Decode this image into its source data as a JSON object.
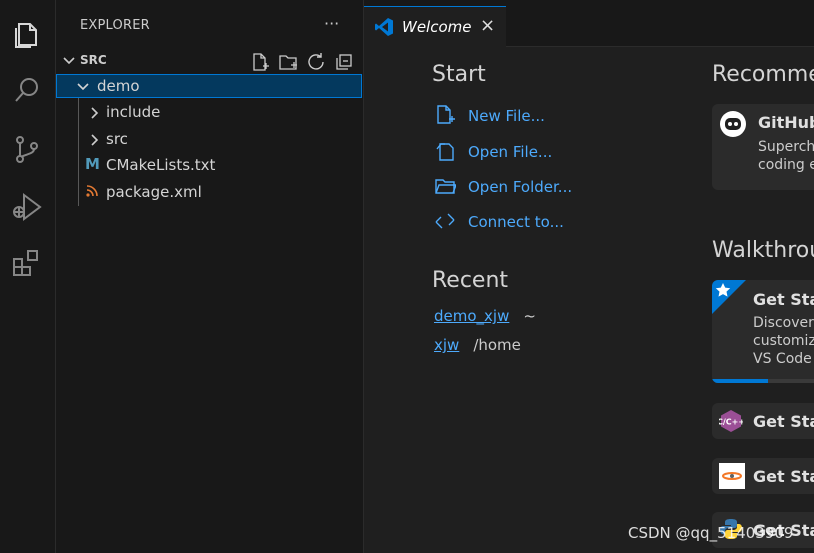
{
  "activity_bar": {
    "icons": [
      "explorer-icon",
      "search-icon",
      "source-control-icon",
      "run-debug-icon",
      "extensions-icon"
    ]
  },
  "sidebar": {
    "title": "EXPLORER",
    "more": "···",
    "section": "SRC",
    "tree": [
      {
        "label": "demo",
        "kind": "folder",
        "expanded": true,
        "selected": true
      },
      {
        "label": "include",
        "kind": "folder",
        "expanded": false
      },
      {
        "label": "src",
        "kind": "folder",
        "expanded": false
      },
      {
        "label": "CMakeLists.txt",
        "kind": "file",
        "icon": "cmake-icon"
      },
      {
        "label": "package.xml",
        "kind": "file",
        "icon": "xml-rss-icon"
      }
    ]
  },
  "tabs": [
    {
      "label": "Welcome",
      "active": true,
      "close": "×"
    }
  ],
  "welcome": {
    "start_heading": "Start",
    "start_items": [
      "New File...",
      "Open File...",
      "Open Folder...",
      "Connect to..."
    ],
    "recent_heading": "Recent",
    "recent_items": [
      {
        "name": "demo_xjw",
        "path": "~"
      },
      {
        "name": "xjw",
        "path": "/home"
      }
    ],
    "recommended_heading": "Recomme",
    "recommended_card": {
      "title": "GitHub",
      "desc_lines": [
        "Superch",
        "coding e"
      ]
    },
    "walkthroughs_heading": "Walkthrou",
    "walkthroughs": [
      {
        "title": "Get Star",
        "desc_lines": [
          "Discover",
          "customiz",
          "VS Code"
        ],
        "progress": 0.55
      },
      {
        "title": "Get Star"
      },
      {
        "title": "Get Star"
      },
      {
        "title": "Get Star"
      }
    ]
  },
  "watermark": "CSDN @qq_51403909",
  "colors": {
    "accent": "#0078d4",
    "link": "#4daafc",
    "selection": "#04395e"
  }
}
